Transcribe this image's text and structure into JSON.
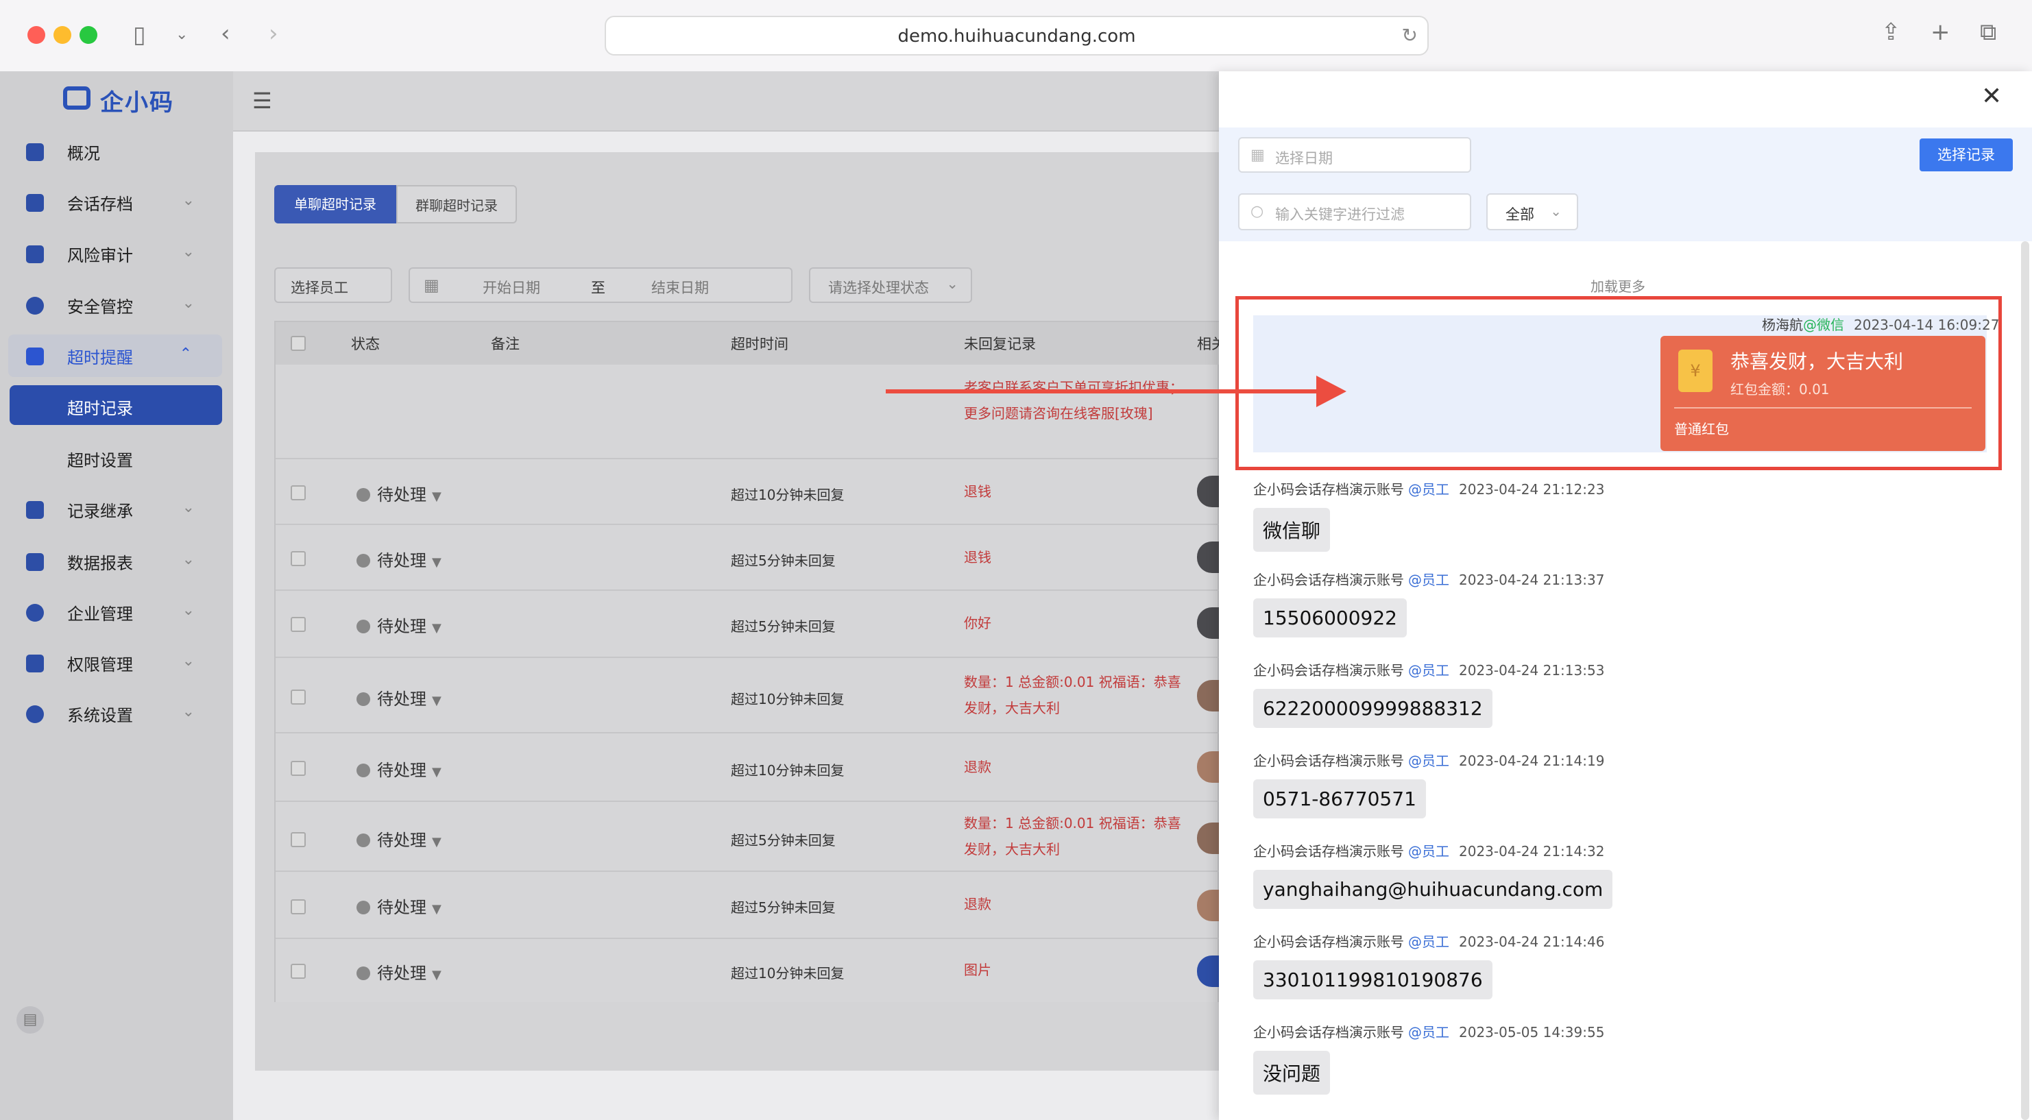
{
  "browser": {
    "url": "demo.huihuacundang.com"
  },
  "sidebar": {
    "logo_text": "企小码",
    "items": [
      {
        "label": "概况",
        "icon": "home-icon"
      },
      {
        "label": "会话存档",
        "icon": "folder-icon"
      },
      {
        "label": "风险审计",
        "icon": "edit-icon"
      },
      {
        "label": "安全管控",
        "icon": "shield-icon"
      },
      {
        "label": "超时提醒",
        "icon": "bell-icon"
      },
      {
        "label": "记录继承",
        "icon": "transfer-icon"
      },
      {
        "label": "数据报表",
        "icon": "chart-icon"
      },
      {
        "label": "企业管理",
        "icon": "refresh-icon"
      },
      {
        "label": "权限管理",
        "icon": "lock-shield-icon"
      },
      {
        "label": "系统设置",
        "icon": "gear-icon"
      }
    ],
    "sub_items": [
      {
        "label": "超时记录"
      },
      {
        "label": "超时设置"
      }
    ]
  },
  "main": {
    "tabs": [
      "单聊超时记录",
      "群聊超时记录"
    ],
    "filters": {
      "employee": "选择员工",
      "start_date": "开始日期",
      "to": "至",
      "end_date": "结束日期",
      "status": "请选择处理状态"
    },
    "table": {
      "columns": [
        "状态",
        "备注",
        "超时时间",
        "未回复记录",
        "相关"
      ],
      "first_row_record": "老客户联系客户下单可享折扣优惠；更多问题请咨询在线客服[玫瑰]",
      "rows": [
        {
          "status": "待处理",
          "time": "超过10分钟未回复",
          "record": "退钱"
        },
        {
          "status": "待处理",
          "time": "超过5分钟未回复",
          "record": "退钱"
        },
        {
          "status": "待处理",
          "time": "超过5分钟未回复",
          "record": "你好"
        },
        {
          "status": "待处理",
          "time": "超过10分钟未回复",
          "record": "数量：1 总金额:0.01 祝福语：恭喜发财，大吉大利"
        },
        {
          "status": "待处理",
          "time": "超过10分钟未回复",
          "record": "退款"
        },
        {
          "status": "待处理",
          "time": "超过5分钟未回复",
          "record": "数量：1 总金额:0.01 祝福语：恭喜发财，大吉大利"
        },
        {
          "status": "待处理",
          "time": "超过5分钟未回复",
          "record": "退款"
        },
        {
          "status": "待处理",
          "time": "超过10分钟未回复",
          "record": "图片"
        }
      ]
    }
  },
  "drawer": {
    "date_placeholder": "选择日期",
    "search_placeholder": "输入关键字进行过滤",
    "type_select": "全部",
    "select_button": "选择记录",
    "load_more": "加载更多",
    "highlight": {
      "sender": "杨海航",
      "channel": "@微信",
      "time": "2023-04-14 16:09:27",
      "red_packet": {
        "title": "恭喜发财，大吉大利",
        "amount_label": "红包金额：",
        "amount": "0.01",
        "type": "普通红包",
        "icon": "yen-icon"
      }
    },
    "messages": [
      {
        "sender": "企小码会话存档演示账号",
        "tag": "@员工",
        "time": "2023-04-24 21:12:23",
        "text": "微信聊"
      },
      {
        "sender": "企小码会话存档演示账号",
        "tag": "@员工",
        "time": "2023-04-24 21:13:37",
        "text": "15506000922"
      },
      {
        "sender": "企小码会话存档演示账号",
        "tag": "@员工",
        "time": "2023-04-24 21:13:53",
        "text": "6222000099998883​12"
      },
      {
        "sender": "企小码会话存档演示账号",
        "tag": "@员工",
        "time": "2023-04-24 21:14:19",
        "text": "0571-86770571"
      },
      {
        "sender": "企小码会话存档演示账号",
        "tag": "@员工",
        "time": "2023-04-24 21:14:32",
        "text": "yanghaihang@huihuacundang.com"
      },
      {
        "sender": "企小码会话存档演示账号",
        "tag": "@员工",
        "time": "2023-04-24 21:14:46",
        "text": "330101199810190876"
      },
      {
        "sender": "企小码会话存档演示账号",
        "tag": "@员工",
        "time": "2023-05-05 14:39:55",
        "text": "没问题"
      }
    ]
  },
  "colors": {
    "accent_blue": "#3b78ee",
    "highlight_red": "#e8463c",
    "red_packet": "#e86a4e",
    "wechat_green": "#27b45a"
  }
}
